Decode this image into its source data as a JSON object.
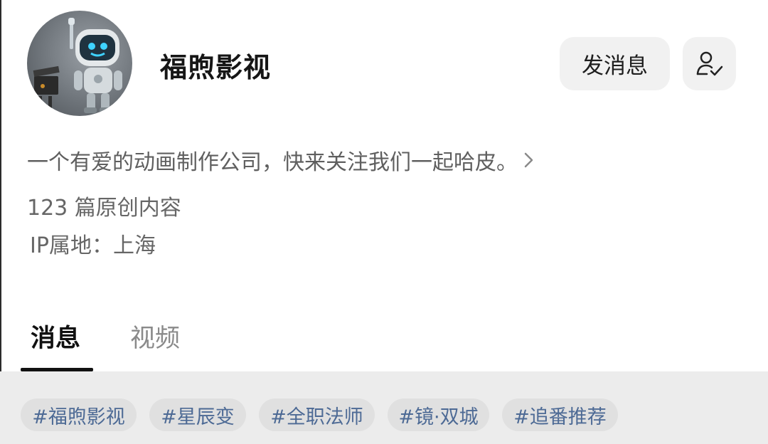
{
  "profile": {
    "name": "福煦影视",
    "avatar_icon": "robot-avatar",
    "bio": "一个有爱的动画制作公司，快来关注我们一起哈皮。",
    "original_count": "123 篇原创内容",
    "ip_location": "IP属地：上海"
  },
  "actions": {
    "send_message_label": "发消息",
    "follow_icon": "user-check-icon"
  },
  "tabs": [
    {
      "label": "消息",
      "active": true
    },
    {
      "label": "视频",
      "active": false
    }
  ],
  "tags": [
    {
      "label": "#福煦影视"
    },
    {
      "label": "#星辰变"
    },
    {
      "label": "#全职法师"
    },
    {
      "label": "#镜·双城"
    },
    {
      "label": "#追番推荐"
    }
  ],
  "colors": {
    "tag_text": "#4d6a95",
    "tag_bg": "#e0e0e0",
    "button_bg": "#f1f1f1",
    "robot_eye": "#3fd3ff"
  }
}
